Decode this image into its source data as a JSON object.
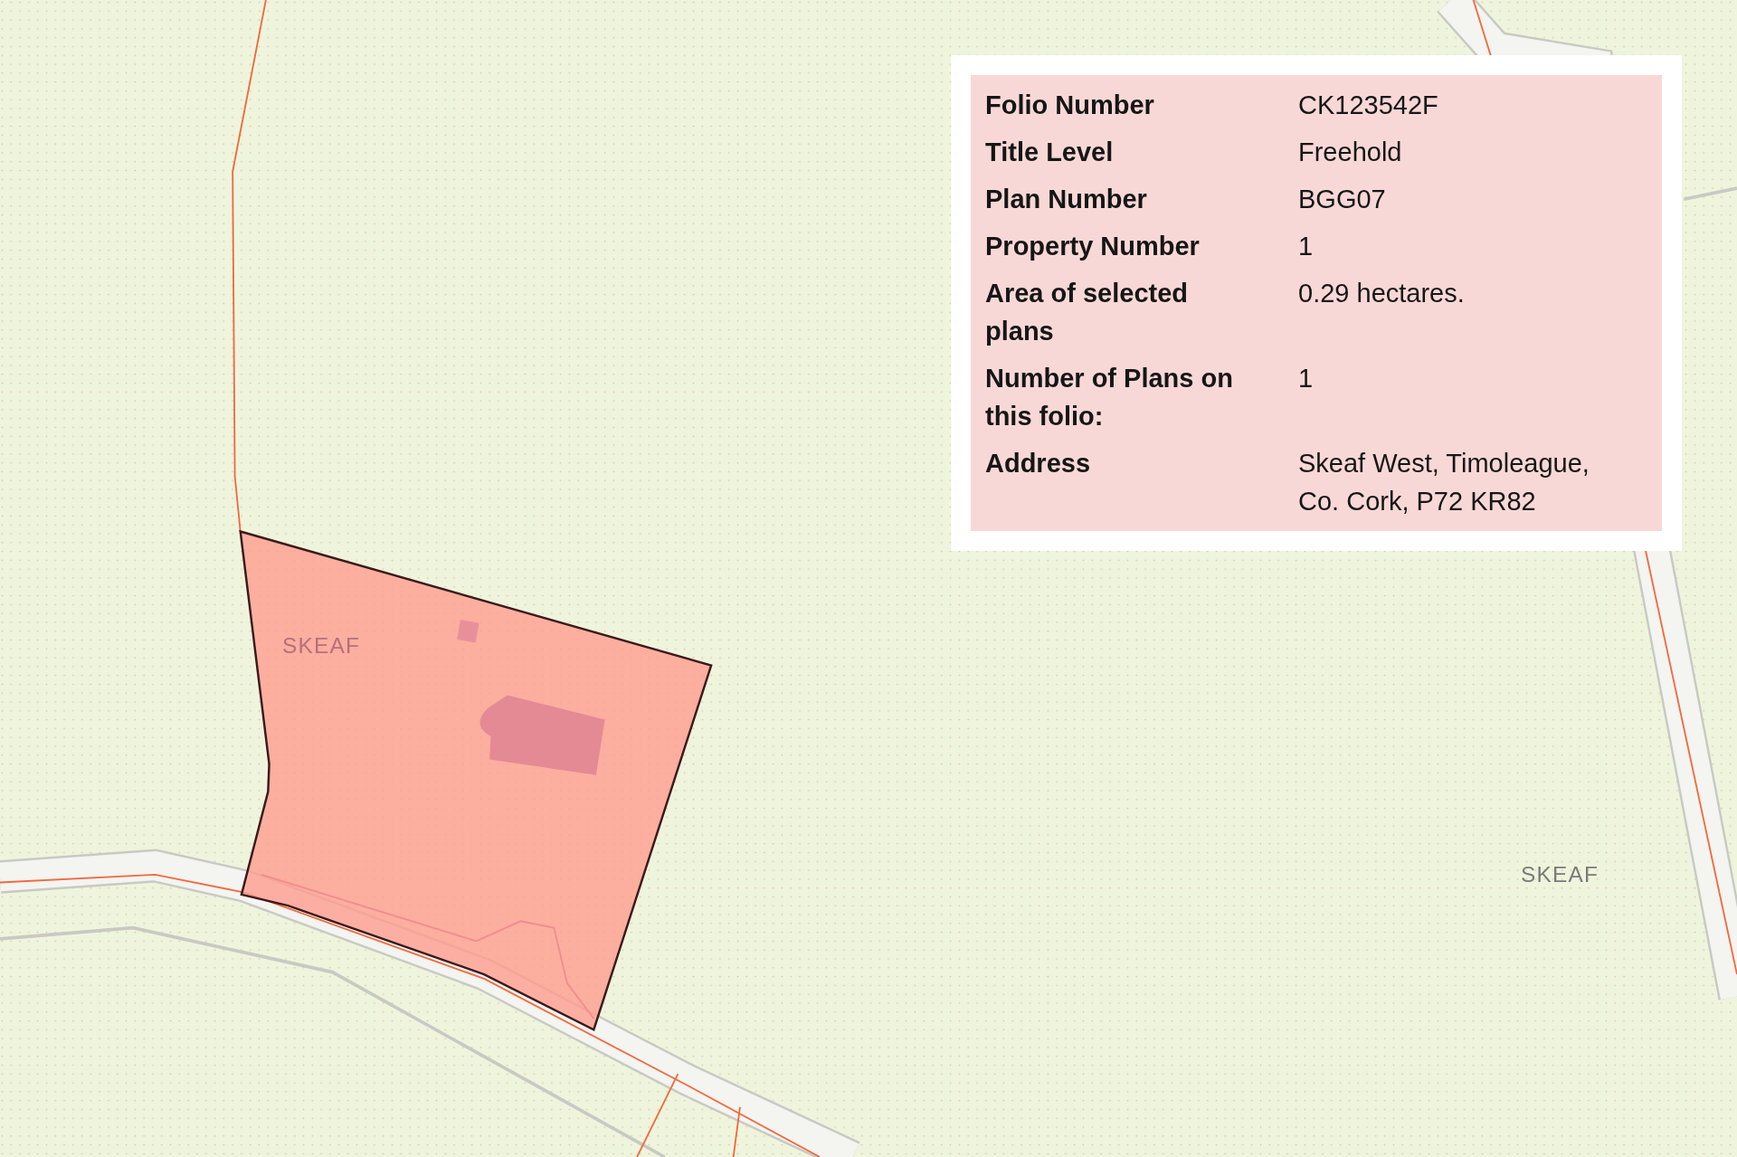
{
  "map": {
    "labels": [
      "SKEAF",
      "SKEAF"
    ]
  },
  "info_popup": {
    "rows": [
      {
        "label": "Folio Number",
        "value": "CK123542F"
      },
      {
        "label": "Title Level",
        "value": "Freehold"
      },
      {
        "label": "Plan Number",
        "value": "BGG07"
      },
      {
        "label": "Property Number",
        "value": "1"
      },
      {
        "label": "Area of selected plans",
        "value": "0.29 hectares."
      },
      {
        "label": "Number of Plans on this folio:",
        "value": "1"
      },
      {
        "label": "Address",
        "value": "Skeaf West, Timoleague, Co. Cork, P72 KR82"
      }
    ]
  }
}
